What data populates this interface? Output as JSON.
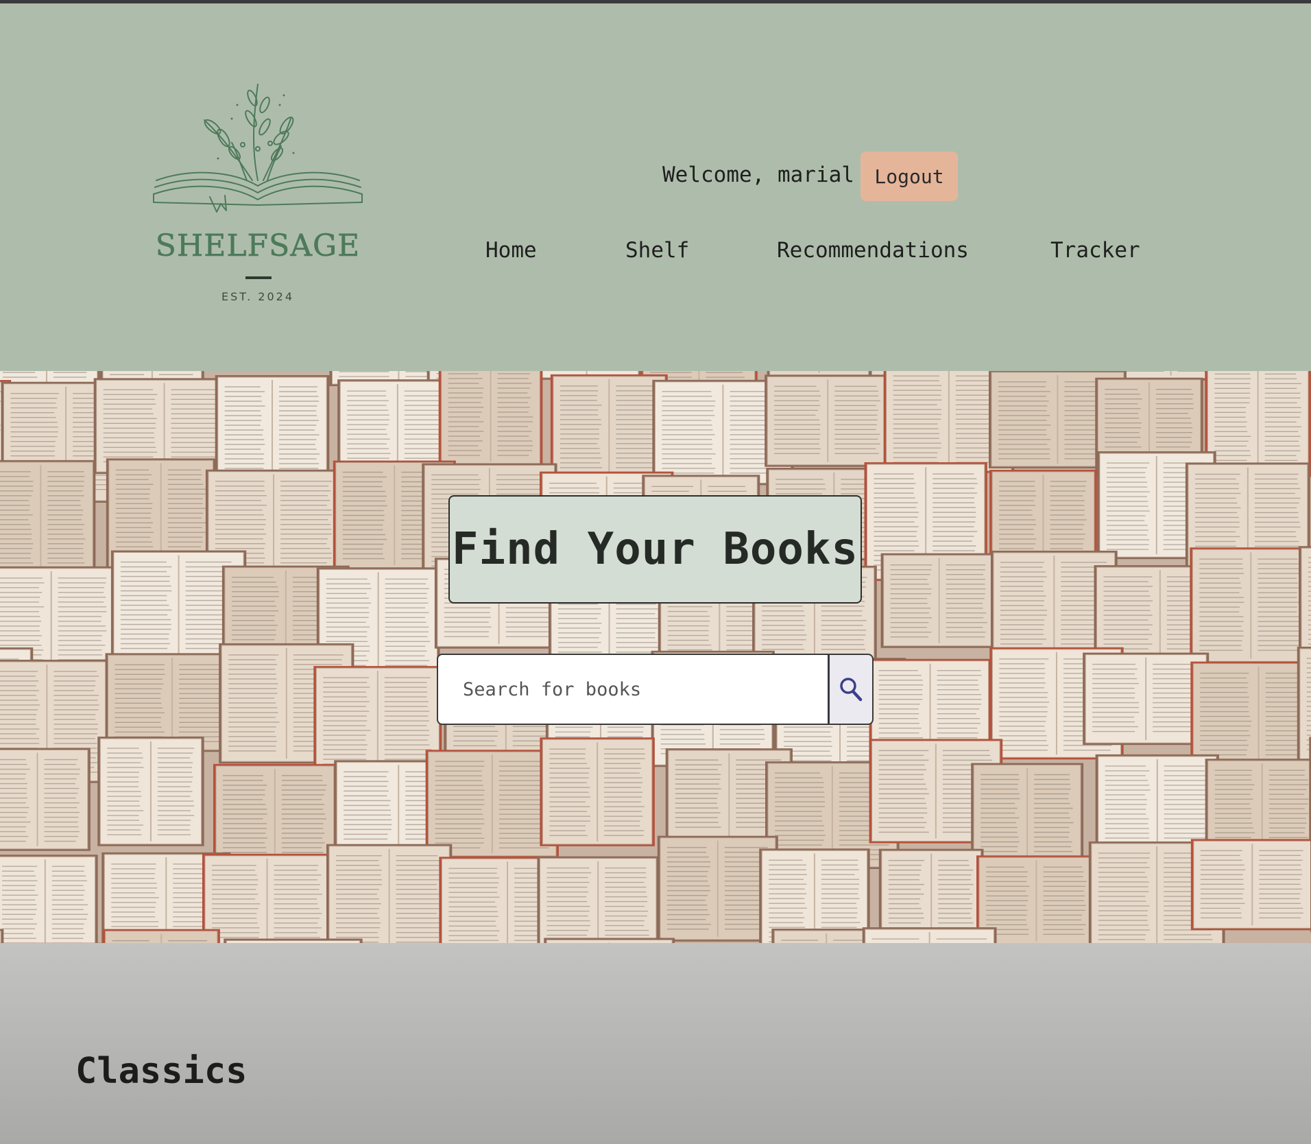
{
  "brand": {
    "name": "SHELFSAGE",
    "established": "EST. 2024",
    "logo_icon": "open-book-plant-icon",
    "color": "#4d7a5a"
  },
  "header": {
    "welcome_text": "Welcome, marial",
    "logout_label": "Logout",
    "logout_color": "#e5b59a",
    "background": "#aebdab"
  },
  "nav": {
    "items": [
      {
        "label": "Home"
      },
      {
        "label": "Shelf"
      },
      {
        "label": "Recommendations"
      },
      {
        "label": "Tracker"
      }
    ]
  },
  "hero": {
    "title": "Find Your Books",
    "search_placeholder": "Search for books",
    "search_icon": "search-icon"
  },
  "sections": [
    {
      "title": "Classics"
    }
  ]
}
